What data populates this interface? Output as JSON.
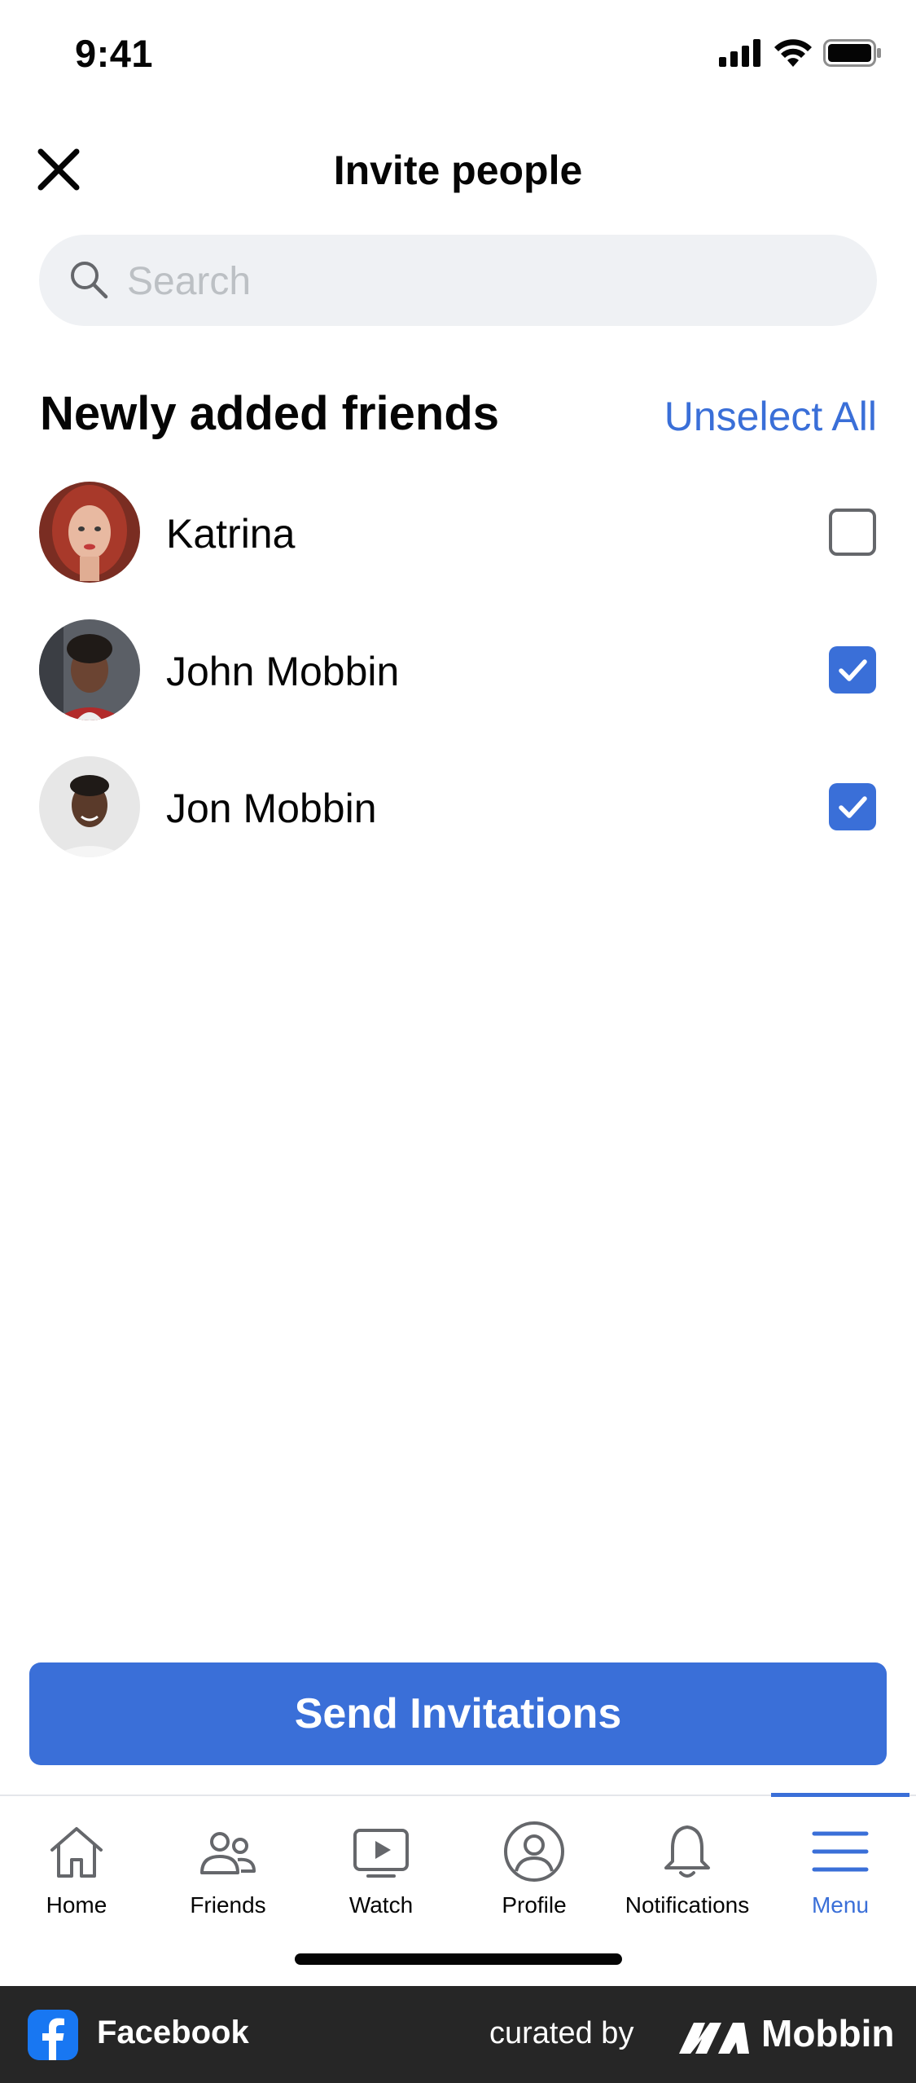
{
  "status_bar": {
    "time": "9:41"
  },
  "header": {
    "title": "Invite people"
  },
  "search": {
    "placeholder": "Search"
  },
  "section": {
    "title": "Newly added friends",
    "action": "Unselect All"
  },
  "friends": [
    {
      "name": "Katrina",
      "selected": false
    },
    {
      "name": "John Mobbin",
      "selected": true
    },
    {
      "name": "Jon Mobbin",
      "selected": true
    }
  ],
  "send_button": {
    "label": "Send Invitations"
  },
  "tabs": [
    {
      "label": "Home",
      "icon": "home-icon",
      "active": false
    },
    {
      "label": "Friends",
      "icon": "friends-icon",
      "active": false
    },
    {
      "label": "Watch",
      "icon": "watch-icon",
      "active": false
    },
    {
      "label": "Profile",
      "icon": "profile-icon",
      "active": false
    },
    {
      "label": "Notifications",
      "icon": "bell-icon",
      "active": false
    },
    {
      "label": "Menu",
      "icon": "menu-icon",
      "active": true
    }
  ],
  "footer": {
    "app_name": "Facebook",
    "curated_by": "curated by",
    "brand": "Mobbin"
  },
  "colors": {
    "accent": "#3a6fd8",
    "search_bg": "#eff1f4",
    "footer_bg": "#262626"
  }
}
